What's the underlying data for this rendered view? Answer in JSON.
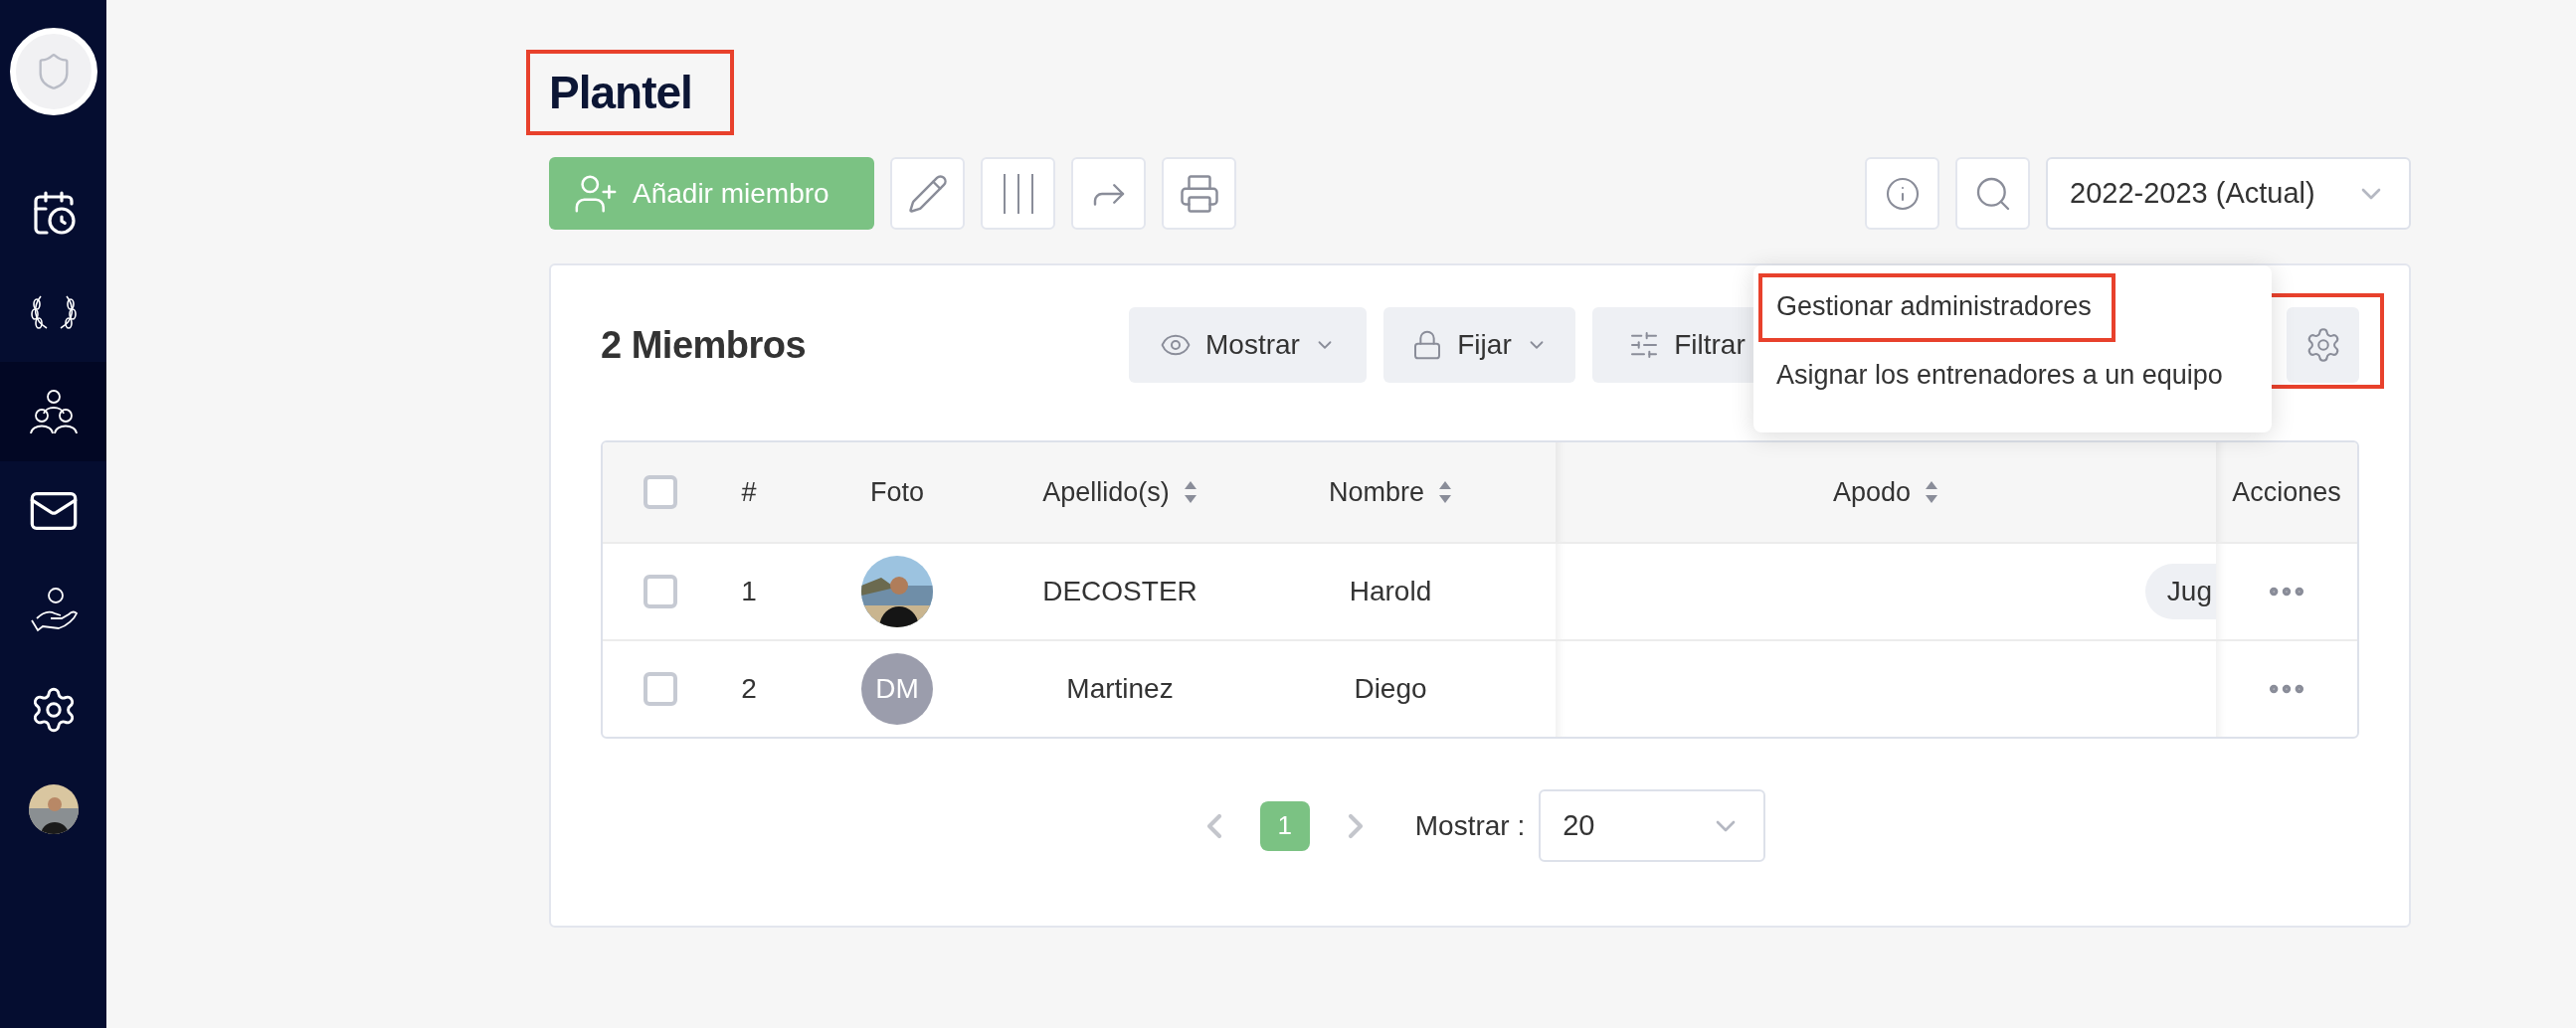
{
  "sidebar": {
    "items": [
      {
        "kind": "calendar",
        "selected": false
      },
      {
        "kind": "laurel",
        "selected": false
      },
      {
        "kind": "people",
        "selected": true
      },
      {
        "kind": "mail",
        "selected": false
      },
      {
        "kind": "care",
        "selected": false
      },
      {
        "kind": "settings",
        "selected": false
      },
      {
        "kind": "avatar",
        "selected": false
      }
    ]
  },
  "page_title": {
    "text": "Plantel",
    "highlighted": true
  },
  "toolbar": {
    "add_button": "Añadir miembro",
    "tools": [
      {
        "kind": "edit"
      },
      {
        "kind": "columns"
      },
      {
        "kind": "share"
      },
      {
        "kind": "print"
      }
    ],
    "season_select": {
      "value": "2022-2023 (Actual)"
    }
  },
  "card": {
    "count": "2 Miembros",
    "filters": [
      {
        "kind": "show",
        "label": "Mostrar"
      },
      {
        "kind": "pin",
        "label": "Fijar"
      },
      {
        "kind": "filter",
        "label": "Filtrar"
      }
    ],
    "settings_highlighted": true,
    "menu": [
      {
        "label": "Gestionar administradores",
        "highlighted": true
      },
      {
        "label": "Asignar los entrenadores a un equipo",
        "highlighted": false
      }
    ]
  },
  "table": {
    "header_checked": false,
    "columns": [
      {
        "kind": "check"
      },
      {
        "kind": "text",
        "label": "#",
        "sortable": false
      },
      {
        "kind": "text",
        "label": "Foto",
        "sortable": false
      },
      {
        "kind": "text",
        "label": "Apellido(s)",
        "sortable": true
      },
      {
        "kind": "text",
        "label": "Nombre",
        "sortable": true
      },
      {
        "kind": "text",
        "label": "Apodo",
        "sortable": true
      },
      {
        "kind": "text",
        "label": "Acciones",
        "sortable": false
      }
    ],
    "rows": [
      {
        "checked": false,
        "number": "1",
        "surname": "DECOSTER",
        "name": "Harold",
        "tag": "Jug"
      },
      {
        "checked": false,
        "number": "2",
        "photo": {
          "kind": "initials",
          "text": "DM"
        },
        "surname": "Martinez",
        "name": "Diego"
      }
    ]
  },
  "pagination": {
    "pages": [
      {
        "label": "1",
        "selected": true
      }
    ],
    "page_size_label": "Mostrar :",
    "page_size": "20"
  }
}
